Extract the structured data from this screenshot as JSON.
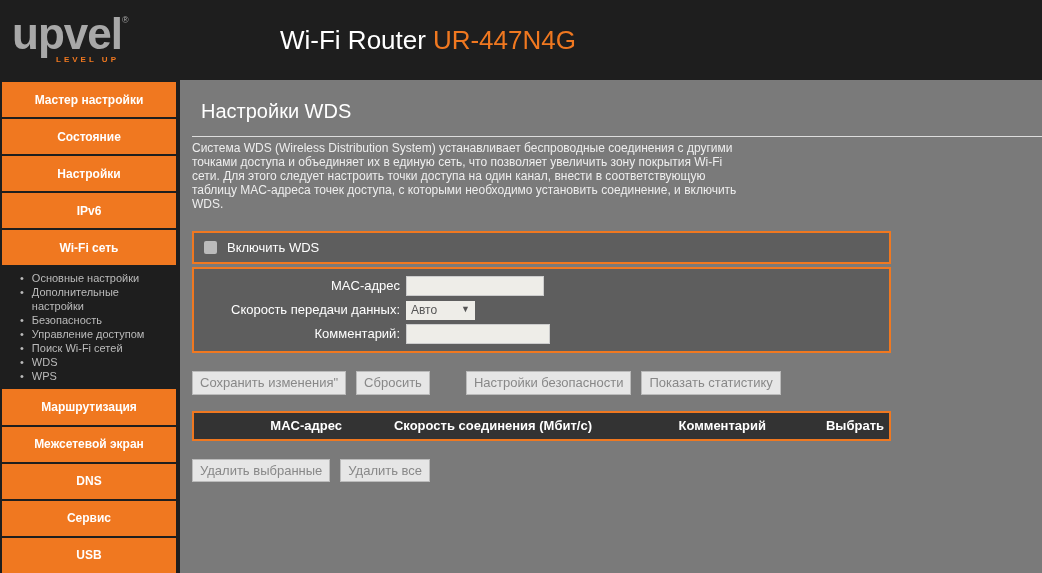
{
  "header": {
    "logo": {
      "name": "upvel",
      "mark": "®",
      "tagline": "LEVEL UP"
    },
    "title": "Wi-Fi Router",
    "model": "UR-447N4G"
  },
  "sidebar": {
    "items": [
      {
        "label": "Мастер настройки"
      },
      {
        "label": "Состояние"
      },
      {
        "label": "Настройки"
      },
      {
        "label": "IPv6"
      },
      {
        "label": "Wi-Fi сеть",
        "children": [
          {
            "marker": "•",
            "label": "Основные настройки"
          },
          {
            "marker": "•",
            "label": "Дополнительные настройки"
          },
          {
            "marker": "•",
            "label": "Безопасность"
          },
          {
            "marker": "•",
            "label": "Управление доступом"
          },
          {
            "marker": "•",
            "label": "Поиск Wi-Fi сетей"
          },
          {
            "marker": "•",
            "label": "WDS"
          },
          {
            "marker": "•",
            "label": "WPS"
          }
        ]
      },
      {
        "label": "Маршрутизация"
      },
      {
        "label": "Межсетевой экран"
      },
      {
        "label": "DNS"
      },
      {
        "label": "Сервис"
      },
      {
        "label": "USB"
      }
    ]
  },
  "page": {
    "title": "Настройки WDS",
    "description": "Система WDS (Wireless Distribution System) устанавливает беспроводные соединения с другими точками доступа и объединяет их в единую сеть, что позволяет увеличить зону покрытия Wi-Fi сети. Для этого следует настроить точки доступа на один канал, внести в соответствующую таблицу MAC-адреса точек доступа, с которыми необходимо установить соединение, и включить WDS."
  },
  "enable": {
    "label": "Включить WDS",
    "checked": false
  },
  "form": [
    {
      "kind": "text",
      "label": "MAC-адрес"
    },
    {
      "kind": "select",
      "label": "Скорость передачи данных:",
      "value": "Авто",
      "caret": "▼"
    },
    {
      "kind": "text",
      "label": "Комментарий:"
    }
  ],
  "button_groups": [
    [
      {
        "label": "Сохранить изменения\"",
        "disabled": true
      },
      {
        "label": "Сбросить",
        "disabled": true
      }
    ],
    [
      {
        "label": "Настройки безопасности",
        "disabled": true
      },
      {
        "label": "Показать статистику",
        "disabled": true
      }
    ]
  ],
  "table": {
    "columns": [
      "MAC-адрес",
      "Скорость соединения (Мбит/с)",
      "Комментарий",
      "Выбрать"
    ]
  },
  "table_buttons": [
    {
      "label": "Удалить выбранные",
      "disabled": true
    },
    {
      "label": "Удалить все",
      "disabled": true
    }
  ]
}
